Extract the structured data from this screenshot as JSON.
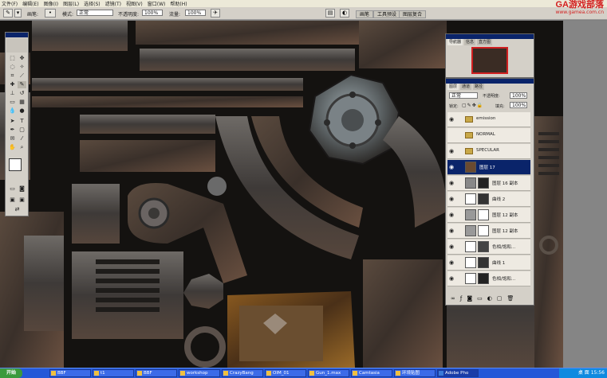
{
  "menu": [
    "文件(F)",
    "编辑(E)",
    "图像(I)",
    "图层(L)",
    "选择(S)",
    "滤镜(T)",
    "视图(V)",
    "窗口(W)",
    "帮助(H)"
  ],
  "brand": {
    "logo": "GA游戏部落",
    "url": "www.gamea.com.cn"
  },
  "options": {
    "brush_label": "画笔:",
    "mode_label": "模式:",
    "mode_value": "正常",
    "opacity_label": "不透明度:",
    "opacity_value": "100%",
    "flow_label": "流量:",
    "flow_value": "100%",
    "tabs": [
      "画笔",
      "工具预设",
      "图层复合"
    ]
  },
  "navigator": {
    "tabs": [
      "导航器",
      "信息",
      "直方图"
    ]
  },
  "layers": {
    "tabs": [
      "图层",
      "通道",
      "路径"
    ],
    "blend_mode": "正常",
    "opacity_label": "不透明度:",
    "opacity_value": "100%",
    "lock_label": "锁定:",
    "fill_label": "填充:",
    "fill_value": "100%",
    "rows": [
      {
        "name": "emission",
        "type": "folder"
      },
      {
        "name": "NORMAL",
        "type": "folder"
      },
      {
        "name": "SPECULAR",
        "type": "folder"
      },
      {
        "name": "图层 17",
        "type": "layer",
        "selected": true
      },
      {
        "name": "图层 16 副本",
        "type": "layer"
      },
      {
        "name": "曲线 2",
        "type": "adjust"
      },
      {
        "name": "图层 12 副本",
        "type": "layer"
      },
      {
        "name": "图层 12 副本",
        "type": "layer"
      },
      {
        "name": "色相/饱和...",
        "type": "adjust"
      },
      {
        "name": "曲线 1",
        "type": "adjust"
      },
      {
        "name": "色相/饱和...",
        "type": "adjust"
      }
    ]
  },
  "taskbar": {
    "start": "开始",
    "tasks": [
      "BBF",
      "t1",
      "BBF",
      "workshop",
      "CrazyBang",
      "OIM_01",
      "Gun_1.max",
      "Camtasia",
      "环境贴图",
      "Adobe Pho"
    ],
    "active_task_index": 9,
    "clock": "15:56",
    "tray_text": "桌 面"
  }
}
